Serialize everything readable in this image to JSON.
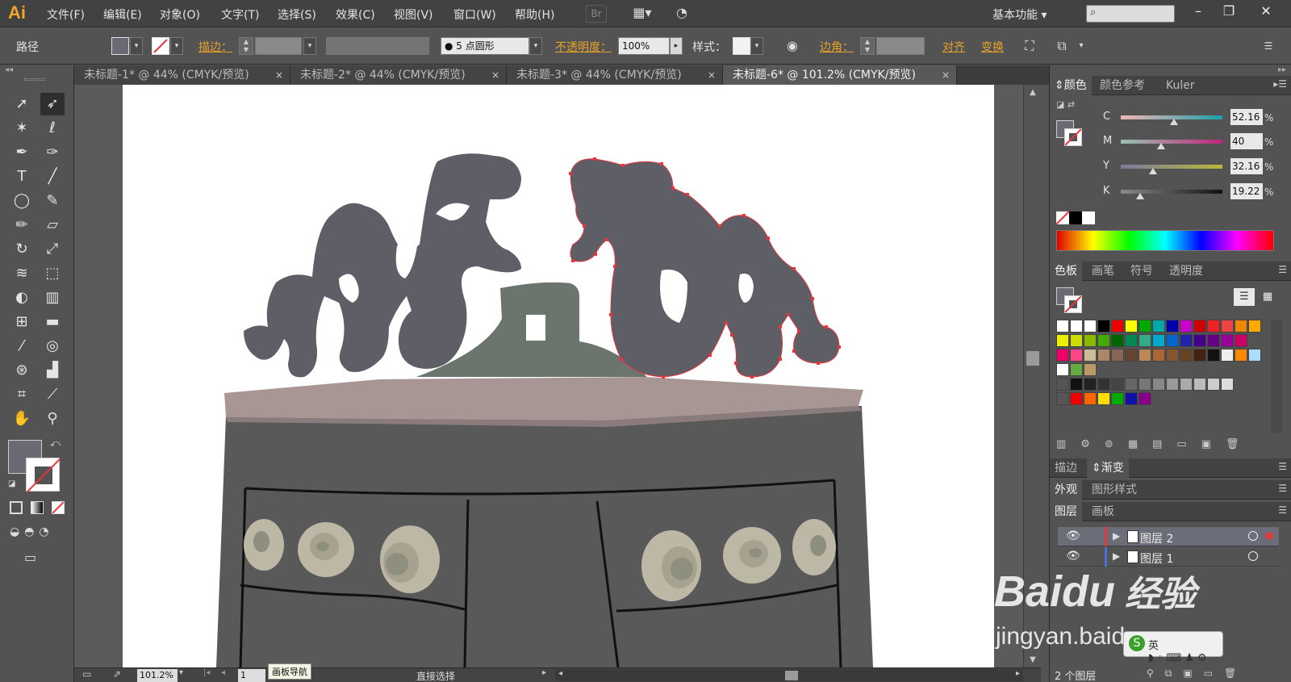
{
  "app": {
    "logo": "Ai"
  },
  "menubar": {
    "items": [
      "文件(F)",
      "编辑(E)",
      "对象(O)",
      "文字(T)",
      "选择(S)",
      "效果(C)",
      "视图(V)",
      "窗口(W)",
      "帮助(H)"
    ],
    "bridge_label": "Br",
    "workspace": "基本功能"
  },
  "control_bar": {
    "object_type": "路径",
    "stroke_label": "描边：",
    "brush_label": "5 点圆形",
    "opacity_label": "不透明度：",
    "opacity_value": "100%",
    "style_label": "样式：",
    "corner_label": "边角：",
    "align_label": "对齐",
    "transform_label": "变换"
  },
  "tabs": [
    {
      "label": "未标题-1* @ 44% (CMYK/预览)",
      "close": "×"
    },
    {
      "label": "未标题-2* @ 44% (CMYK/预览)",
      "close": "×"
    },
    {
      "label": "未标题-3* @ 44% (CMYK/预览)",
      "close": "×"
    },
    {
      "label": "未标题-6* @ 101.2% (CMYK/预览)",
      "close": "×",
      "active": true
    }
  ],
  "status": {
    "zoom": "101.2%",
    "page": "1",
    "tooltip": "画板导航",
    "tool": "直接选择"
  },
  "color_panel": {
    "tabs": [
      "颜色",
      "颜色参考",
      "Kuler"
    ],
    "channels": [
      {
        "label": "C",
        "value": "52.16",
        "fill": 0.52,
        "grad": [
          "#f4b6b6",
          "#1aa0a8"
        ]
      },
      {
        "label": "M",
        "value": "40",
        "fill": 0.4,
        "grad": [
          "#9ac2b0",
          "#c0257c"
        ]
      },
      {
        "label": "Y",
        "value": "32.16",
        "fill": 0.32,
        "grad": [
          "#7c7aa0",
          "#b7b83a"
        ]
      },
      {
        "label": "K",
        "value": "19.22",
        "fill": 0.19,
        "grad": [
          "#8a8a8a",
          "#111111"
        ]
      }
    ],
    "percent": "%"
  },
  "swatches_panel": {
    "tabs": [
      "色板",
      "画笔",
      "符号",
      "透明度"
    ]
  },
  "stroke_panel": {
    "tabs": [
      "描边",
      "渐变"
    ]
  },
  "appearance_panel": {
    "tabs": [
      "外观",
      "图形样式"
    ]
  },
  "layers_panel": {
    "tabs": [
      "图层",
      "画板"
    ],
    "layers": [
      "图层 2",
      "图层 1"
    ],
    "footer": "2 个图层"
  },
  "watermark": {
    "brand": "Baidu",
    "brand_cn": "经验",
    "url": "jingyan.baidu.com"
  },
  "colors": {
    "fill_swatch": "#6a6a74",
    "selection": "#e8343a",
    "dragon": "#5e5e66",
    "cabinet": "#595959",
    "top": "#a89694",
    "mound": "#6c746e",
    "eye": "#bdb7a5"
  }
}
